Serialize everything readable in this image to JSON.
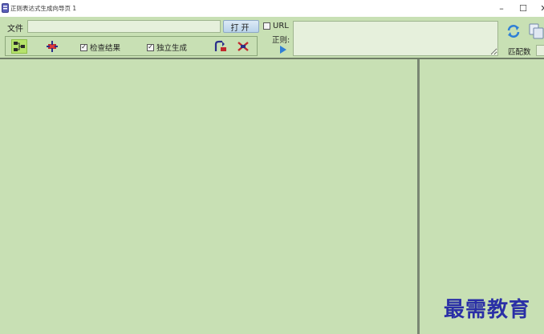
{
  "window": {
    "title": "正则表达式生成向导页 1",
    "minimize_glyph": "–",
    "maximize_glyph": "☐",
    "close_glyph": "✕"
  },
  "toolbar": {
    "file_label": "文件",
    "file_path_value": "",
    "open_button_label": "打开",
    "check_result": {
      "label": "检查结果",
      "checked": true
    },
    "independent_generate": {
      "label": "独立生成",
      "checked": true
    },
    "url": {
      "label": "URL",
      "checked": false
    },
    "regex_label": "正则:",
    "regex_value": "",
    "match_count_label": "匹配数"
  },
  "icons": {
    "tree_view": "tree-structure-icon",
    "add_node": "node-add-icon",
    "link_node": "node-link-icon",
    "remove_node": "node-remove-icon",
    "run": "play-icon",
    "refresh": "refresh-icon",
    "copy": "copy-icon"
  },
  "colors": {
    "background": "#c8e0b4",
    "titlebar": "#ffffff",
    "accent_blue": "#2f7fd6",
    "watermark": "#2a2fa6"
  },
  "watermark": "最需教育"
}
